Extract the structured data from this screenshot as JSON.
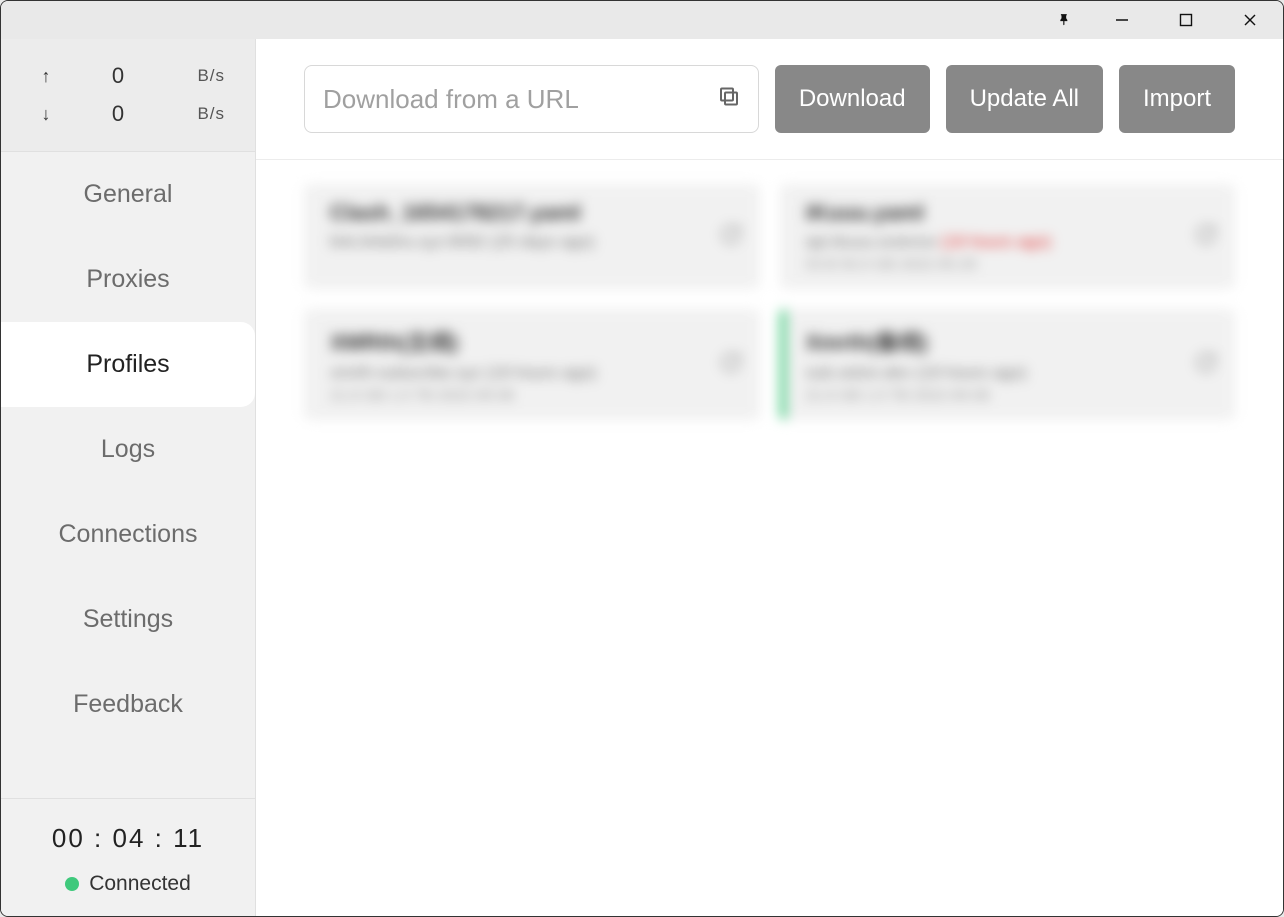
{
  "speed": {
    "up_arrow": "↑",
    "up_value": "0",
    "up_unit": "B/s",
    "down_arrow": "↓",
    "down_value": "0",
    "down_unit": "B/s"
  },
  "nav": {
    "general": "General",
    "proxies": "Proxies",
    "profiles": "Profiles",
    "logs": "Logs",
    "connections": "Connections",
    "settings": "Settings",
    "feedback": "Feedback"
  },
  "status": {
    "timer": "00 : 04 : 11",
    "label": "Connected"
  },
  "toolbar": {
    "url_placeholder": "Download from a URL",
    "download": "Download",
    "update_all": "Update All",
    "import": "Import"
  },
  "cards": [
    {
      "title": "Clash_1654178217.yaml",
      "sub_host": "link.linkdns.xyz:9092",
      "sub_time": "(25 days ago)",
      "sub_time_red": false,
      "meta": ""
    },
    {
      "title": "iKuuu.yaml",
      "sub_host": "api.ikuuu.science",
      "sub_time": "(19 hours ago)",
      "sub_time_red": true,
      "meta": "53 B   50.0 GB   2022-05-29"
    },
    {
      "title": "XMRth(主线)",
      "sub_host": "xmrth-subscribe.xyz",
      "sub_time": "(19 hours ago)",
      "sub_time_red": false,
      "meta": "21.6 GB   1.5 TB   2022-09-08"
    },
    {
      "title": "Xmrth(备线)",
      "sub_host": "sub.xeton.dev",
      "sub_time": "(19 hours ago)",
      "sub_time_red": false,
      "meta": "21.6 GB   1.5 TB   2022-09-08"
    }
  ]
}
